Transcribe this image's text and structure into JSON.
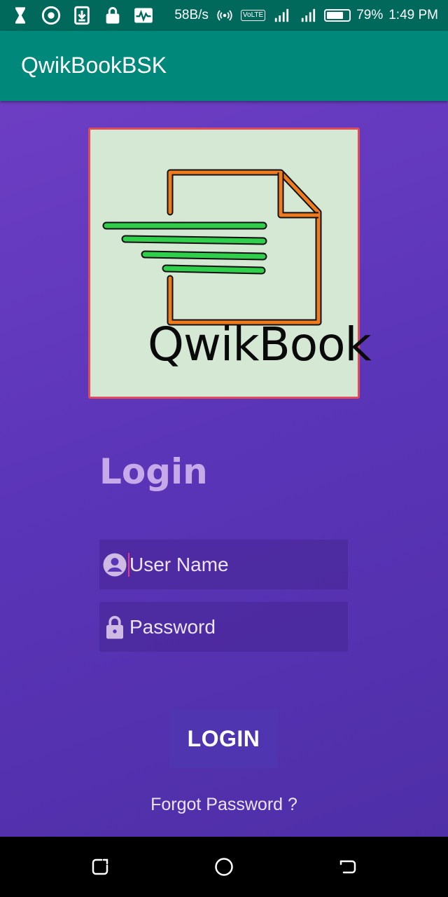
{
  "status_bar": {
    "icons": [
      "hourglass-icon",
      "target-icon",
      "download-icon",
      "lock-icon",
      "activity-icon"
    ],
    "net_speed": "58B/s",
    "volte": "VoLTE",
    "battery_percent": "79%",
    "battery_level": 0.79,
    "time": "1:49 PM"
  },
  "app_bar": {
    "title": "QwikBookBSK"
  },
  "logo": {
    "text": "QwikBook"
  },
  "login": {
    "heading": "Login",
    "username_placeholder": "User Name",
    "password_placeholder": "Password",
    "button_label": "LOGIN",
    "forgot_label": "Forgot Password ?"
  },
  "colors": {
    "status_bar": "#00695c",
    "app_bar": "#00897b",
    "background": "#5b35b8",
    "heading": "#c6a9e8",
    "logo_border": "#e04b5c"
  },
  "nav_bar": {
    "icons": [
      "recents-icon",
      "home-icon",
      "back-icon"
    ]
  }
}
